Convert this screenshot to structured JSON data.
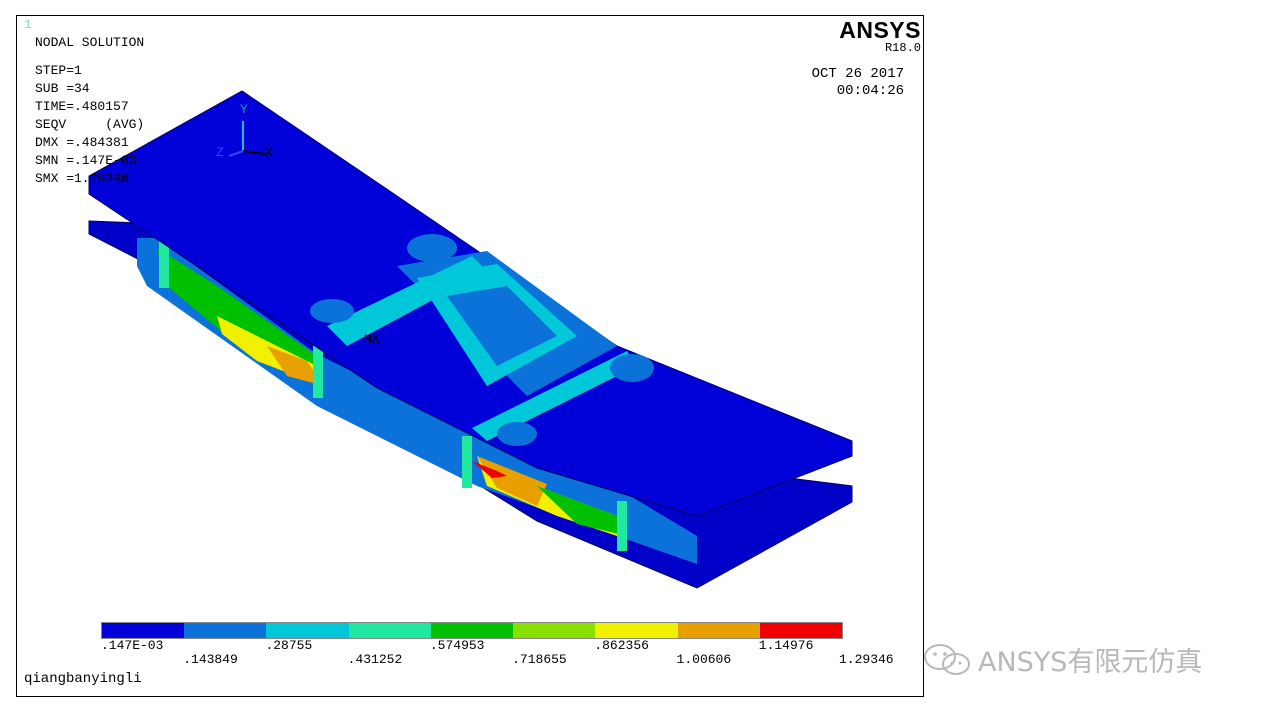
{
  "window_number": "1",
  "logo": {
    "brand": "ANSYS",
    "release": "R18.0"
  },
  "header": {
    "title": "NODAL SOLUTION",
    "info_lines": [
      "STEP=1",
      "SUB =34",
      "TIME=.480157",
      "SEQV     (AVG)",
      "DMX =.484381",
      "SMN =.147E-03",
      "SMX =1.29346"
    ]
  },
  "date": "OCT 26 2017",
  "time": "00:04:26",
  "triad": {
    "y": "Y",
    "z": "Z",
    "x": "X"
  },
  "mx_marker": "MX",
  "legend": {
    "colors": [
      "#0000d8",
      "#0a72d8",
      "#00c8d8",
      "#20e8a0",
      "#00c000",
      "#88e000",
      "#f0f000",
      "#e8a000",
      "#f00000"
    ],
    "labels_top": [
      ".147E-03",
      ".28755",
      ".574953",
      ".862356",
      "1.14976"
    ],
    "labels_bottom": [
      ".143849",
      ".431252",
      ".718655",
      "1.00606",
      "1.29346"
    ]
  },
  "footer": {
    "user": "qiangbanyingli"
  },
  "watermark": {
    "icon": "wechat-icon",
    "text": "ANSYS有限元仿真"
  }
}
